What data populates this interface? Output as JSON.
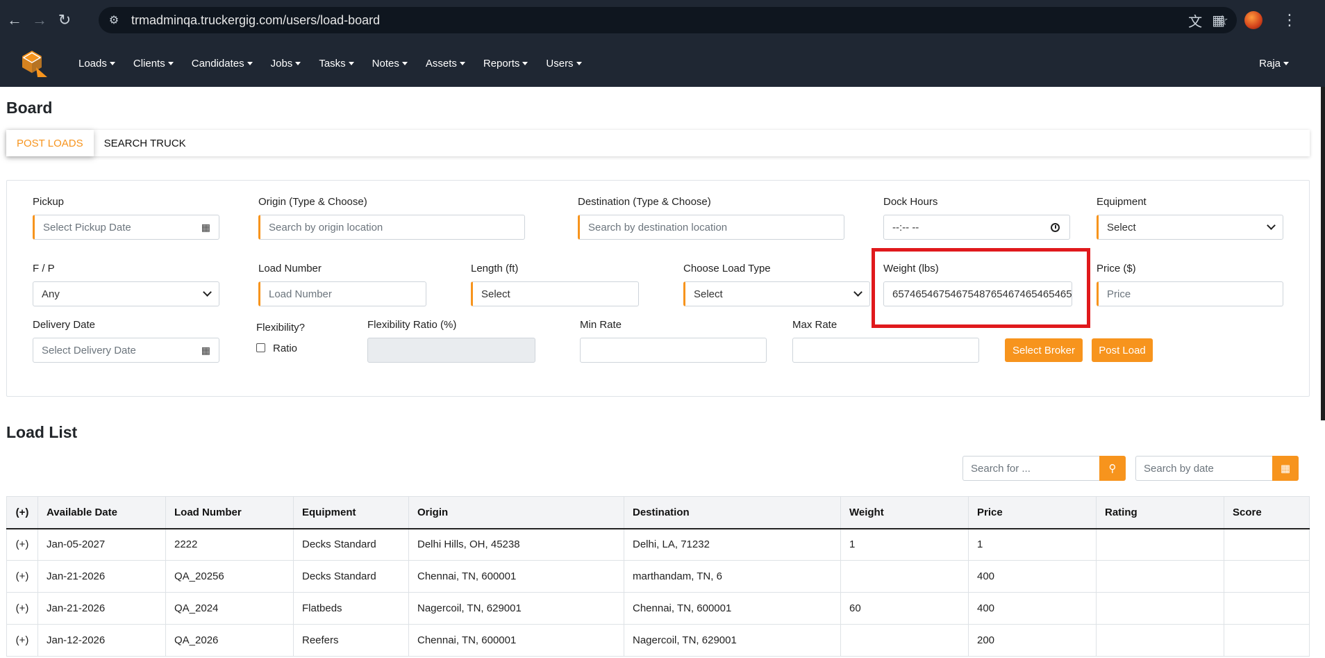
{
  "browser": {
    "url": "trmadminqa.truckergig.com/users/load-board"
  },
  "navbar": {
    "menu": [
      "Loads",
      "Clients",
      "Candidates",
      "Jobs",
      "Tasks",
      "Notes",
      "Assets",
      "Reports",
      "Users"
    ],
    "user": "Raja"
  },
  "page": {
    "title": "Board",
    "tabs": [
      "POST LOADS",
      "SEARCH TRUCK"
    ]
  },
  "form": {
    "pickup": {
      "label": "Pickup",
      "placeholder": "Select Pickup Date"
    },
    "origin": {
      "label": "Origin (Type & Choose)",
      "placeholder": "Search by origin location"
    },
    "destination": {
      "label": "Destination (Type & Choose)",
      "placeholder": "Search by destination location"
    },
    "dock_hours": {
      "label": "Dock Hours",
      "value": "--:-- --"
    },
    "equipment": {
      "label": "Equipment",
      "value": "Select"
    },
    "fp": {
      "label": "F / P",
      "value": "Any"
    },
    "load_number": {
      "label": "Load Number",
      "placeholder": "Load Number"
    },
    "length": {
      "label": "Length (ft)",
      "placeholder": "Select"
    },
    "load_type": {
      "label": "Choose Load Type",
      "value": "Select"
    },
    "weight": {
      "label": "Weight (lbs)",
      "value": "6574654675467548765467465465465"
    },
    "price": {
      "label": "Price ($)",
      "placeholder": "Price"
    },
    "delivery_date": {
      "label": "Delivery Date",
      "placeholder": "Select Delivery Date"
    },
    "flexibility": {
      "label": "Flexibility?",
      "checkbox_label": "Ratio"
    },
    "flexibility_ratio": {
      "label": "Flexibility Ratio (%)"
    },
    "min_rate": {
      "label": "Min Rate"
    },
    "max_rate": {
      "label": "Max Rate"
    },
    "select_broker": "Select Broker",
    "post_load": "Post Load"
  },
  "load_list": {
    "title": "Load List",
    "search_placeholder": "Search for ...",
    "date_placeholder": "Search by date",
    "columns": [
      "(+)",
      "Available Date",
      "Load Number",
      "Equipment",
      "Origin",
      "Destination",
      "Weight",
      "Price",
      "Rating",
      "Score"
    ],
    "rows": [
      [
        "(+)",
        "Jan-05-2027",
        "2222",
        "Decks Standard",
        "Delhi Hills, OH, 45238",
        "Delhi, LA, 71232",
        "1",
        "1",
        "",
        ""
      ],
      [
        "(+)",
        "Jan-21-2026",
        "QA_20256",
        "Decks Standard",
        "Chennai, TN, 600001",
        "marthandam, TN, 6",
        "",
        "400",
        "",
        ""
      ],
      [
        "(+)",
        "Jan-21-2026",
        "QA_2024",
        "Flatbeds",
        "Nagercoil, TN, 629001",
        "Chennai, TN, 600001",
        "60",
        "400",
        "",
        ""
      ],
      [
        "(+)",
        "Jan-12-2026",
        "QA_2026",
        "Reefers",
        "Chennai, TN, 600001",
        "Nagercoil, TN, 629001",
        "",
        "200",
        "",
        ""
      ]
    ]
  },
  "colors": {
    "accent": "#f7941d",
    "nav_bg": "#1f2733",
    "highlight": "#e0191c"
  }
}
